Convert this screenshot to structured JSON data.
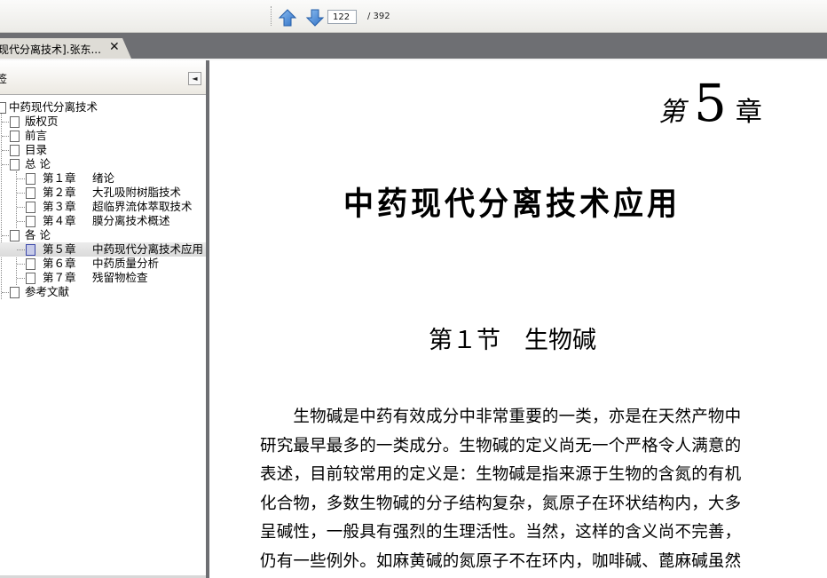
{
  "toolbar": {
    "prev_icon": "arrow-up-icon",
    "next_icon": "arrow-down-icon",
    "current_page": "122",
    "total_pages": "/ 392"
  },
  "tab": {
    "title": "现代分离技术].张东...",
    "close": "✕"
  },
  "sidebar": {
    "header": "签",
    "collapse": "◄",
    "items": [
      {
        "label": "中药现代分离技术"
      },
      {
        "label": "版权页"
      },
      {
        "label": "前言"
      },
      {
        "label": "目录"
      },
      {
        "label": "总  论"
      },
      {
        "chapter": "第１章",
        "label": "绪论"
      },
      {
        "chapter": "第２章",
        "label": "大孔吸附树脂技术"
      },
      {
        "chapter": "第３章",
        "label": "超临界流体萃取技术"
      },
      {
        "chapter": "第４章",
        "label": "膜分离技术概述"
      },
      {
        "label": "各  论"
      },
      {
        "chapter": "第５章",
        "label": "中药现代分离技术应用"
      },
      {
        "chapter": "第６章",
        "label": "中药质量分析"
      },
      {
        "chapter": "第７章",
        "label": "残留物检查"
      },
      {
        "label": "参考文献"
      }
    ]
  },
  "document": {
    "chapter_prefix": "第",
    "chapter_number": "5",
    "chapter_suffix": "章",
    "title": "中药现代分离技术应用",
    "section": "第１节　生物碱",
    "paragraph_lines": [
      "　　生物碱是中药有效成分中非常重要的一类，亦是在天然产物中",
      "研究最早最多的一类成分。生物碱的定义尚无一个严格令人满意的",
      "表述，目前较常用的定义是：生物碱是指来源于生物的含氮的有机",
      "化合物，多数生物碱的分子结构复杂，氮原子在环状结构内，大多",
      "呈碱性，一般具有强烈的生理活性。当然，这样的含义尚不完善，",
      "仍有一些例外。如麻黄碱的氮原子不在环内，咖啡碱、蓖麻碱虽然"
    ]
  }
}
